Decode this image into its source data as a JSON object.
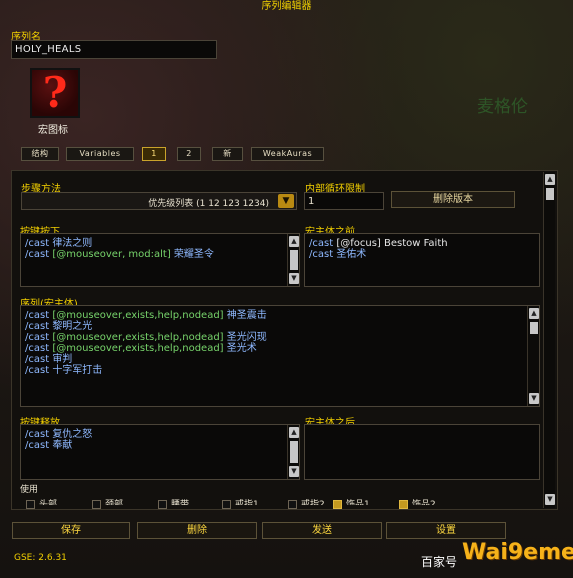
{
  "window_title": "序列编辑器",
  "sequence_name_label": "序列名",
  "sequence_name_value": "HOLY_HEALS",
  "macro_icon_label": "宏图标",
  "macro_icon_glyph": "?",
  "tabs": [
    {
      "label": "结构"
    },
    {
      "label": "Variables"
    },
    {
      "label": "1"
    },
    {
      "label": "2"
    },
    {
      "label": "新"
    },
    {
      "label": "WeakAuras"
    }
  ],
  "step_method": {
    "label": "步骤方法",
    "value": "优先级列表 (1 12 123 1234)"
  },
  "inner_loop": {
    "label": "内部循环限制",
    "value": "1"
  },
  "delete_version_button": "删除版本",
  "keypress": {
    "label": "按键按下",
    "lines": [
      [
        {
          "t": "/cast ",
          "c": "blue"
        },
        {
          "t": "律法之则",
          "c": "blue"
        }
      ],
      [
        {
          "t": "/cast ",
          "c": "blue"
        },
        {
          "t": "[@mouseover, mod:alt]",
          "c": "green"
        },
        {
          "t": " 荣耀圣令",
          "c": "blue"
        }
      ]
    ]
  },
  "pre_macro": {
    "label": "宏主体之前",
    "lines": [
      [
        {
          "t": "/cast ",
          "c": "blue"
        },
        {
          "t": "[@focus] Bestow Faith",
          "c": "white"
        }
      ],
      [
        {
          "t": "/cast ",
          "c": "blue"
        },
        {
          "t": "圣佑术",
          "c": "blue"
        }
      ]
    ]
  },
  "sequence": {
    "label": "序列(宏主体)",
    "lines": [
      [
        {
          "t": "/cast ",
          "c": "blue"
        },
        {
          "t": "[@mouseover,exists,help,nodead]",
          "c": "green"
        },
        {
          "t": " 神圣震击",
          "c": "blue"
        }
      ],
      [
        {
          "t": "/cast ",
          "c": "blue"
        },
        {
          "t": "黎明之光",
          "c": "blue"
        }
      ],
      [
        {
          "t": "/cast ",
          "c": "blue"
        },
        {
          "t": "[@mouseover,exists,help,nodead]",
          "c": "green"
        },
        {
          "t": " 圣光闪现",
          "c": "blue"
        }
      ],
      [
        {
          "t": "/cast ",
          "c": "blue"
        },
        {
          "t": "[@mouseover,exists,help,nodead]",
          "c": "green"
        },
        {
          "t": " 圣光术",
          "c": "blue"
        }
      ],
      [
        {
          "t": "/cast ",
          "c": "blue"
        },
        {
          "t": "审判",
          "c": "blue"
        }
      ],
      [
        {
          "t": "/cast ",
          "c": "blue"
        },
        {
          "t": "十字军打击",
          "c": "blue"
        }
      ]
    ]
  },
  "keyrelease": {
    "label": "按键释放",
    "lines": [
      [
        {
          "t": "/cast ",
          "c": "blue"
        },
        {
          "t": "复仇之怒",
          "c": "blue"
        }
      ],
      [
        {
          "t": "/cast ",
          "c": "blue"
        },
        {
          "t": "奉献",
          "c": "blue"
        }
      ]
    ]
  },
  "post_macro": {
    "label": "宏主体之后",
    "lines": []
  },
  "use_label": "使用",
  "use_items": [
    {
      "label": "头部",
      "checked": false
    },
    {
      "label": "颈部",
      "checked": false
    },
    {
      "label": "腰带",
      "checked": false
    },
    {
      "label": "戒指1",
      "checked": false
    },
    {
      "label": "戒指2",
      "checked": false
    },
    {
      "label": "饰品1",
      "checked": true
    },
    {
      "label": "饰品2",
      "checked": true
    }
  ],
  "buttons": {
    "save": "保存",
    "delete": "删除",
    "send": "发送",
    "settings": "设置"
  },
  "version": "GSE: 2.6.31",
  "watermark": "百家号",
  "background_name": "麦格伦",
  "colors": {
    "accent": "#f2cf00",
    "code_blue": "#8fb9ff",
    "code_green": "#77d36b"
  }
}
